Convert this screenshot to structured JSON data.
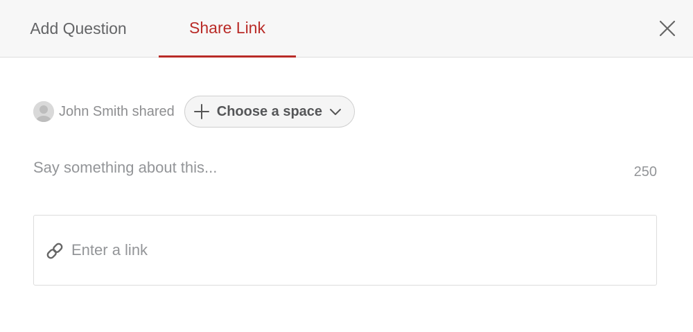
{
  "tabs": [
    {
      "label": "Add Question",
      "active": false
    },
    {
      "label": "Share Link",
      "active": true
    }
  ],
  "share": {
    "user_text": "John Smith shared",
    "space_button_label": "Choose a space"
  },
  "comment": {
    "placeholder": "Say something about this...",
    "char_remaining": "250"
  },
  "link": {
    "placeholder": "Enter a link"
  },
  "icons": {
    "close": "close-icon",
    "avatar": "avatar-icon",
    "plus": "plus-icon",
    "chevron": "chevron-down-icon",
    "link": "link-icon"
  },
  "colors": {
    "accent": "#b92b27",
    "header_bg": "#f7f7f7",
    "muted_text": "#939598"
  }
}
